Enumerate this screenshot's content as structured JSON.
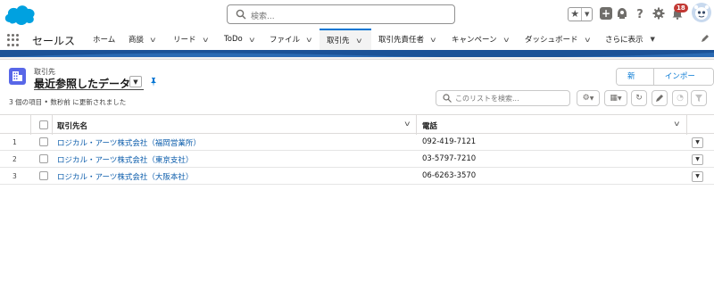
{
  "global_header": {
    "search_placeholder": "検索...",
    "notification_count": "18"
  },
  "nav": {
    "app_name": "セールス",
    "tabs": [
      {
        "label": "ホーム",
        "has_menu": false
      },
      {
        "label": "商談",
        "has_menu": true
      },
      {
        "label": "リード",
        "has_menu": true
      },
      {
        "label": "ToDo",
        "has_menu": true
      },
      {
        "label": "ファイル",
        "has_menu": true
      },
      {
        "label": "取引先",
        "has_menu": true,
        "active": true
      },
      {
        "label": "取引先責任者",
        "has_menu": true
      },
      {
        "label": "キャンペーン",
        "has_menu": true
      },
      {
        "label": "ダッシュボード",
        "has_menu": true
      },
      {
        "label": "さらに表示",
        "has_menu": true
      }
    ]
  },
  "list_header": {
    "object_label": "取引先",
    "view_title": "最近参照したデータ",
    "status": "3 個の項目 • 数秒前 に更新されました",
    "new_button": "新規",
    "import_button": "インポート",
    "search_placeholder": "このリストを検索..."
  },
  "table": {
    "columns": [
      "取引先名",
      "電話"
    ],
    "rows": [
      {
        "num": "1",
        "name": "ロジカル・アーツ株式会社（福岡営業所）",
        "phone": "092-419-7121"
      },
      {
        "num": "2",
        "name": "ロジカル・アーツ株式会社（東京支社）",
        "phone": "03-5797-7210"
      },
      {
        "num": "3",
        "name": "ロジカル・アーツ株式会社（大阪本社）",
        "phone": "06-6263-3570"
      }
    ]
  },
  "colors": {
    "brand_blue": "#0176d3",
    "link_blue": "#0b5cab",
    "accounts_icon": "#5867e8",
    "strip_blue": "#1b5297",
    "badge_red": "#c23934"
  },
  "icons": [
    "salesforce-logo",
    "search-icon",
    "star-icon",
    "plus-icon",
    "trailhead-icon",
    "help-icon",
    "gear-icon",
    "bell-icon",
    "app-launcher-icon",
    "pin-icon",
    "settings-icon",
    "table-view-icon",
    "refresh-icon",
    "edit-icon",
    "chart-icon",
    "filter-icon"
  ]
}
